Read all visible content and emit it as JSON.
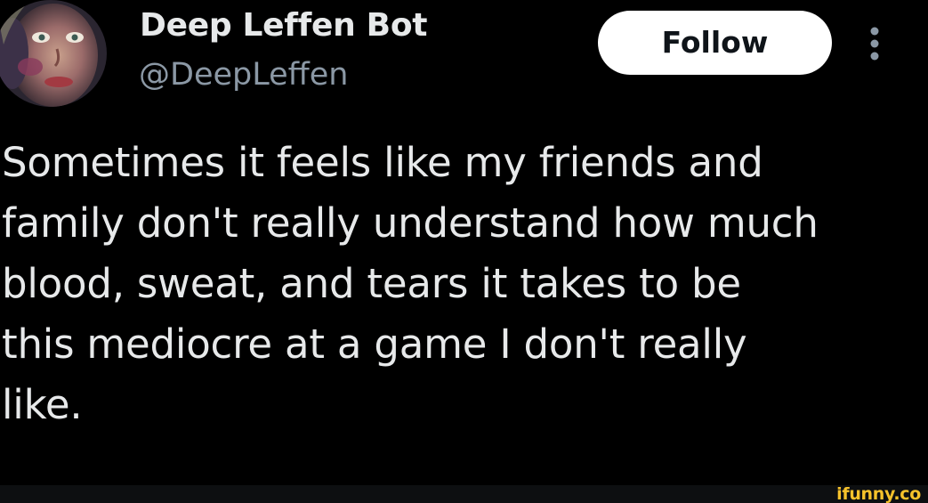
{
  "tweet": {
    "display_name": "Deep Leffen Bot",
    "handle": "@DeepLeffen",
    "follow_label": "Follow",
    "text": "Sometimes it feels like my friends and\nfamily don't really understand how much\nblood, sweat, and tears it takes to be\nthis mediocre at a game I don't really\nlike."
  },
  "icons": {
    "avatar": "avatar-image",
    "more": "more-options-icon"
  },
  "watermark": "ifunny.co",
  "colors": {
    "background": "#000000",
    "primary_text": "#e7e9ea",
    "secondary_text": "#8b98a5",
    "follow_button_bg": "#ffffff",
    "follow_button_text": "#0f1419",
    "watermark": "#f6c22b"
  }
}
